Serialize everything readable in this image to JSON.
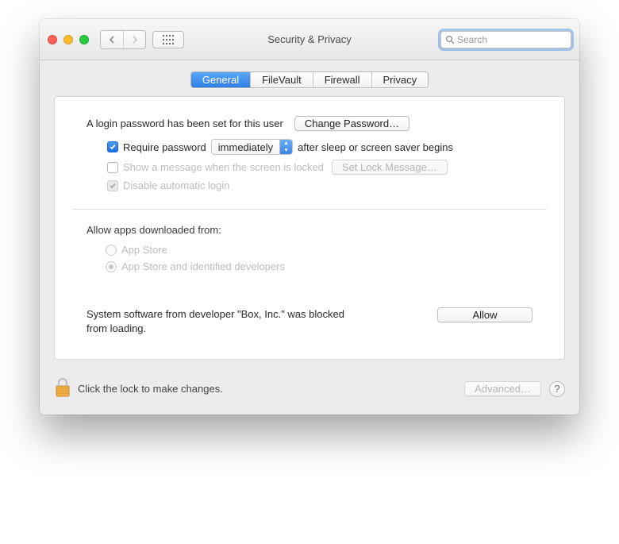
{
  "window_title": "Security & Privacy",
  "search": {
    "placeholder": "Search"
  },
  "tabs": {
    "general": "General",
    "filevault": "FileVault",
    "firewall": "Firewall",
    "privacy": "Privacy",
    "active": "general"
  },
  "login": {
    "password_set_text": "A login password has been set for this user",
    "change_password_btn": "Change Password…",
    "require_password_label": "Require password",
    "require_password_checked": true,
    "delay_value": "immediately",
    "after_sleep_text": "after sleep or screen saver begins",
    "show_message_label": "Show a message when the screen is locked",
    "show_message_checked": false,
    "set_lock_msg_btn": "Set Lock Message…",
    "disable_auto_login_label": "Disable automatic login",
    "disable_auto_login_checked": true
  },
  "gatekeeper": {
    "header": "Allow apps downloaded from:",
    "opt_app_store": "App Store",
    "opt_identified": "App Store and identified developers",
    "selected": "identified"
  },
  "blocked": {
    "message": "System software from developer \"Box, Inc.\" was blocked from loading.",
    "allow_btn": "Allow"
  },
  "footer": {
    "lock_text": "Click the lock to make changes.",
    "advanced_btn": "Advanced…"
  }
}
